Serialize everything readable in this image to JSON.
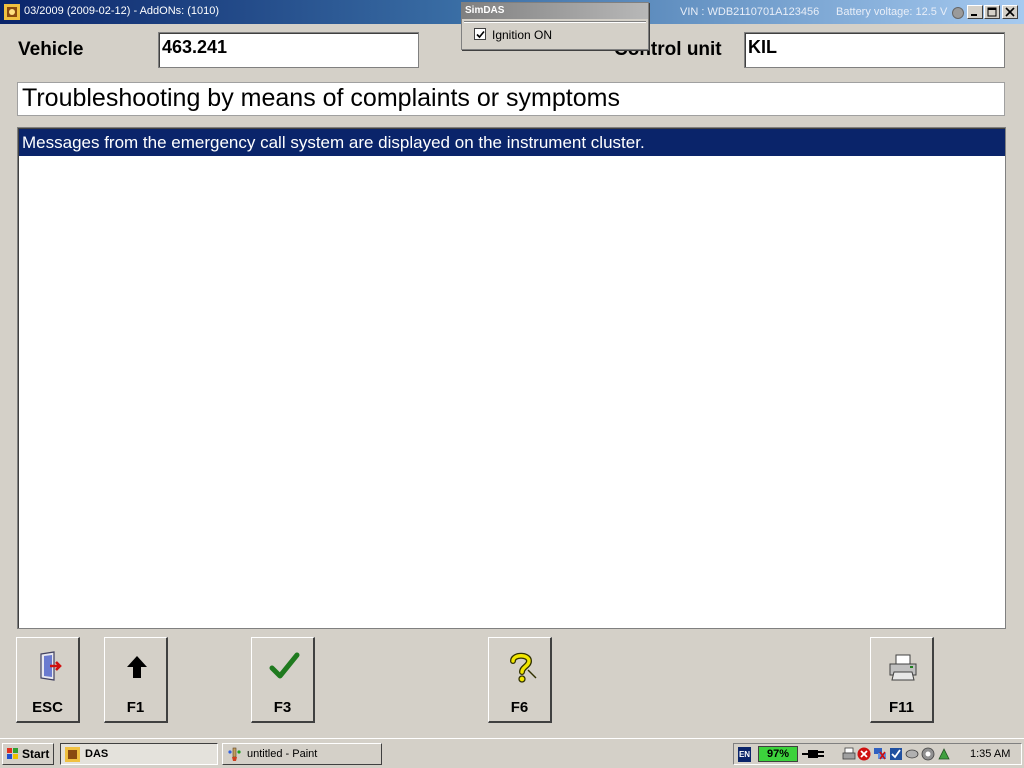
{
  "window": {
    "title": "03/2009 (2009-02-12) - AddONs: (1010)",
    "vin": "VIN : WDB2110701A123456",
    "battery_voltage": "Battery voltage: 12.5 V"
  },
  "simdas": {
    "title": "SimDAS",
    "ignition_label": "Ignition ON",
    "ignition_checked": true
  },
  "header": {
    "vehicle_label": "Vehicle",
    "vehicle_value": "463.241",
    "control_unit_label": "Control unit",
    "control_unit_value": "KIL"
  },
  "heading": "Troubleshooting by means of complaints or symptoms",
  "list": {
    "items": [
      {
        "text": "Messages from the emergency call system are displayed on the instrument cluster.",
        "selected": true
      }
    ]
  },
  "function_keys": [
    {
      "label": "ESC",
      "icon": "exit-door-icon"
    },
    {
      "label": "F1",
      "icon": "arrow-up-icon"
    },
    {
      "label": "F3",
      "icon": "checkmark-icon"
    },
    {
      "label": "F6",
      "icon": "help-question-icon"
    },
    {
      "label": "F11",
      "icon": "printer-icon"
    }
  ],
  "taskbar": {
    "start_label": "Start",
    "tasks": [
      {
        "label": "DAS",
        "active": true
      },
      {
        "label": "untitled - Paint",
        "active": false
      }
    ],
    "language": "EN",
    "battery_percent": "97%",
    "clock": "1:35 AM"
  },
  "colors": {
    "selection": "#0a246a",
    "window_bg": "#d4d0c8",
    "battery_green": "#3cd23c"
  }
}
